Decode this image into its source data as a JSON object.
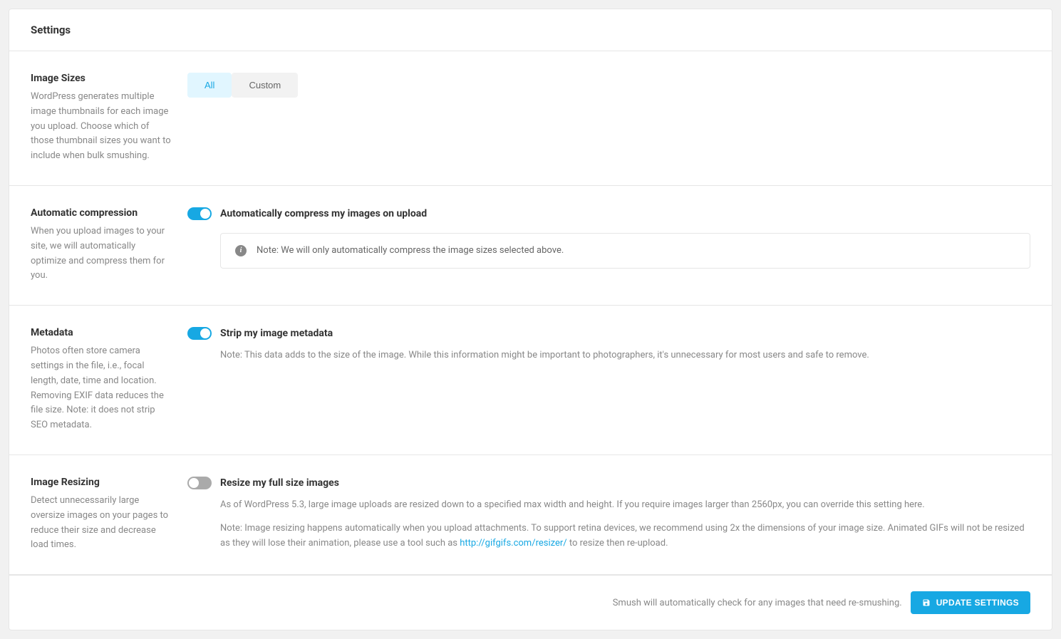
{
  "header": {
    "title": "Settings"
  },
  "sections": {
    "image_sizes": {
      "title": "Image Sizes",
      "description": "WordPress generates multiple image thumbnails for each image you upload. Choose which of those thumbnail sizes you want to include when bulk smushing.",
      "tabs": {
        "all": "All",
        "custom": "Custom"
      }
    },
    "automatic_compression": {
      "title": "Automatic compression",
      "description": "When you upload images to your site, we will automatically optimize and compress them for you.",
      "toggle_label": "Automatically compress my images on upload",
      "note": "Note: We will only automatically compress the image sizes selected above."
    },
    "metadata": {
      "title": "Metadata",
      "description": "Photos often store camera settings in the file, i.e., focal length, date, time and location. Removing EXIF data reduces the file size. Note: it does not strip SEO metadata.",
      "toggle_label": "Strip my image metadata",
      "note": "Note: This data adds to the size of the image. While this information might be important to photographers, it's unnecessary for most users and safe to remove."
    },
    "image_resizing": {
      "title": "Image Resizing",
      "description": "Detect unnecessarily large oversize images on your pages to reduce their size and decrease load times.",
      "toggle_label": "Resize my full size images",
      "note1": "As of WordPress 5.3, large image uploads are resized down to a specified max width and height. If you require images larger than 2560px, you can override this setting here.",
      "note2_before": "Note: Image resizing happens automatically when you upload attachments. To support retina devices, we recommend using 2x the dimensions of your image size. Animated GIFs will not be resized as they will lose their animation, please use a tool such as ",
      "note2_link": "http://gifgifs.com/resizer/",
      "note2_after": " to resize then re-upload."
    }
  },
  "footer": {
    "text": "Smush will automatically check for any images that need re-smushing.",
    "button": "UPDATE SETTINGS"
  }
}
